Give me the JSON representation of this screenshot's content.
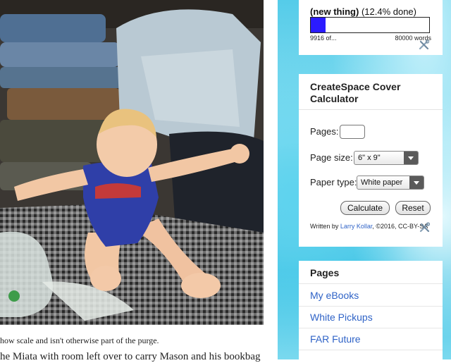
{
  "post": {
    "caption": "how scale and isn't otherwise part of the purge.",
    "body_fragment": "he Miata with room left over to carry Mason and his bookbag"
  },
  "progress_widget": {
    "label_bold": "(new thing)",
    "label_rest": " (12.4% done)",
    "percent_done": 12.4,
    "count_label": "9916 of...",
    "goal_label": "80000 words",
    "fill_color": "#2b1bff"
  },
  "calculator_widget": {
    "title": "CreateSpace Cover Calculator",
    "pages_label": "Pages:",
    "pages_value": "",
    "page_size_label": "Page size:",
    "page_size_value": "6\" x 9\"",
    "paper_type_label": "Paper type:",
    "paper_type_value": "White paper",
    "calculate_label": "Calculate",
    "reset_label": "Reset",
    "credit_prefix": "Written by ",
    "credit_author": "Larry Kollar",
    "credit_suffix": ", ©2016, CC-BY-SA"
  },
  "pages_widget": {
    "title": "Pages",
    "items": [
      {
        "label": "My eBooks"
      },
      {
        "label": "White Pickups"
      },
      {
        "label": "FAR Future"
      }
    ]
  },
  "icons": {
    "edit": "screwdriver-wrench-icon"
  },
  "colors": {
    "link": "#2f63c7",
    "sidebar_accent": "#55cce9"
  }
}
